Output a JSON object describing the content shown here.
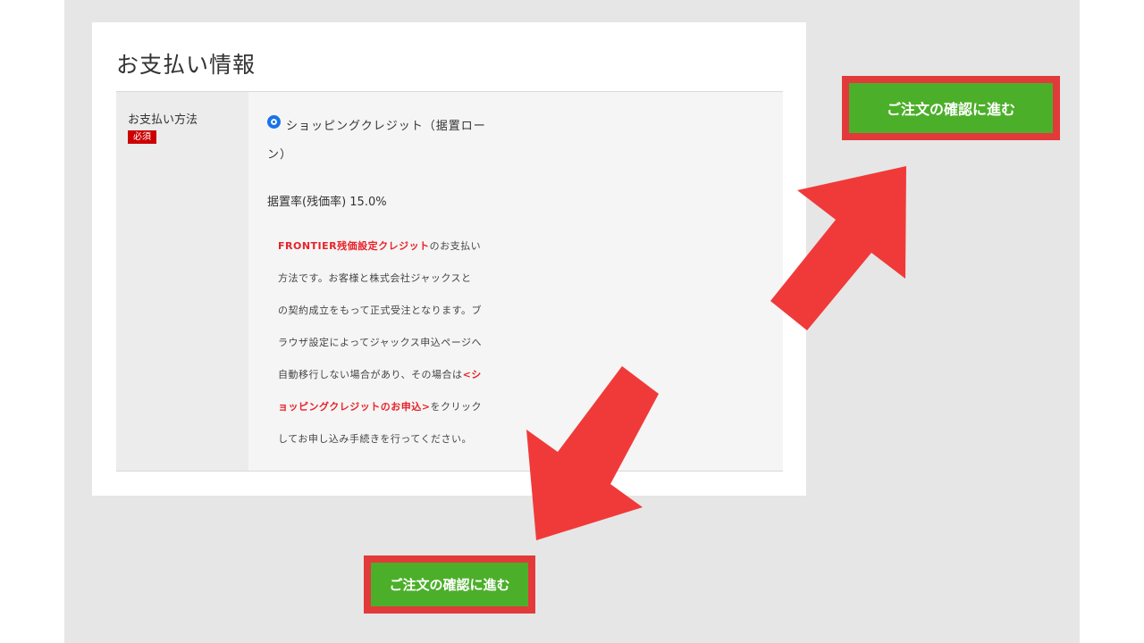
{
  "section": {
    "title": "お支払い情報"
  },
  "payment": {
    "label": "お支払い方法",
    "required_badge": "必須",
    "option_label_line1": "ショッピングクレジット（据置ロー",
    "option_label_line2": "ン）",
    "rate_text": "据置率(残価率) 15.0%",
    "description": {
      "l1_red": "FRONTIER残価設定クレジット",
      "l1_rest": "のお支払い",
      "l2": "方法です。お客様と株式会社ジャックスと",
      "l3": "の契約成立をもって正式受注となります。ブ",
      "l4": "ラウザ設定によってジャックス申込ページへ",
      "l5_start": "自動移行しない場合があり、その場合は",
      "l5_red": "<シ",
      "l6_red": "ョッピングクレジットのお申込>",
      "l6_rest": "をクリック",
      "l7": "してお申し込み手続きを行ってください。"
    }
  },
  "buttons": {
    "confirm_top": "ご注文の確認に進む",
    "confirm_bottom": "ご注文の確認に進む"
  },
  "colors": {
    "accent_red": "#e23a3a",
    "button_green": "#4caf2a",
    "radio_blue": "#1a73e8",
    "badge_red": "#cc0000"
  }
}
